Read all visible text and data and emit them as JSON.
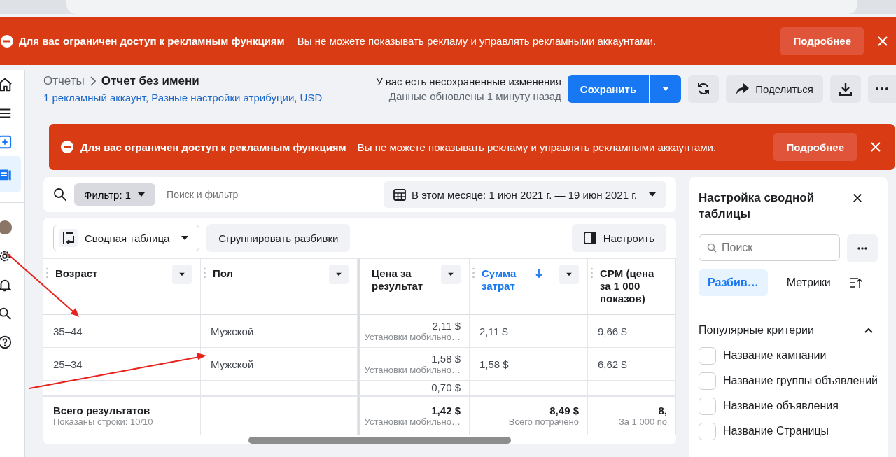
{
  "alert_banners": [
    {
      "title": "Для вас ограничен доступ к рекламным функциям",
      "message": "Вы не можете показывать рекламу и управлять рекламными аккаунтами.",
      "button": "Подробнее"
    },
    {
      "title": "Для вас ограничен доступ к рекламным функциям",
      "message": "Вы не можете показывать рекламу и управлять рекламными аккаунтами.",
      "button": "Подробнее"
    }
  ],
  "sidebar": {
    "items": [
      {
        "selected": false
      },
      {
        "selected": false
      },
      {
        "selected": false
      },
      {
        "selected": true
      },
      {
        "selected": false
      },
      {
        "selected": false
      },
      {
        "selected": false
      },
      {
        "selected": false
      },
      {
        "selected": false
      }
    ]
  },
  "header": {
    "breadcrumb": "Отчеты",
    "title": "Отчет без имени",
    "subtitle": "1 рекламный аккаунт, Разные настройки атрибуции, USD",
    "status": "У вас есть несохраненные изменения",
    "updated": "Данные обновлены 1 минуту назад",
    "save_button": "Сохранить",
    "share_button": "Поделиться"
  },
  "filter_bar": {
    "filter_chip": "Фильтр: 1",
    "placeholder": "Поиск и фильтр",
    "date_range": "В этом месяце: 1 июн 2021 г. — 19 июн 2021 г."
  },
  "toolbar": {
    "view_select": "Сводная таблица",
    "group_button": "Сгруппировать разбивки",
    "customize_button": "Настроить"
  },
  "table": {
    "columns": [
      {
        "label": "Возраст",
        "sorted": false
      },
      {
        "label": "Пол",
        "sorted": false
      },
      {
        "label": "Цена за результат",
        "sorted": false
      },
      {
        "label": "Сумма затрат",
        "sorted": true
      },
      {
        "label": "CPM (цена за 1 000 показов)",
        "sorted": false
      }
    ],
    "rows": [
      {
        "cells": [
          {
            "value": "35–44"
          },
          {
            "value": "Мужской"
          },
          {
            "value": "2,11 $",
            "note": "Установки мобильно…"
          },
          {
            "value": "2,11 $"
          },
          {
            "value": "9,66 $"
          }
        ]
      },
      {
        "cells": [
          {
            "value": "25–34"
          },
          {
            "value": "Мужской"
          },
          {
            "value": "1,58 $",
            "note": "Установки мобильно…"
          },
          {
            "value": "1,58 $"
          },
          {
            "value": "6,62 $"
          }
        ]
      },
      {
        "cells": [
          {},
          {},
          {
            "value": "0,70 $"
          },
          {},
          {}
        ]
      }
    ],
    "totals": {
      "label": "Всего результатов",
      "caption": "Показаны строки: 10/10",
      "metrics": [
        {
          "value": "1,42 $",
          "note": "Установки мобильно…"
        },
        {
          "value": "8,49 $",
          "note": "Всего потрачено"
        },
        {
          "value": "8,",
          "note": "За 1 000 по"
        }
      ]
    }
  },
  "panel": {
    "title": "Настройка сводной таблицы",
    "search_placeholder": "Поиск",
    "tabs": [
      {
        "label": "Разбив…",
        "selected": true
      },
      {
        "label": "Метрики",
        "selected": false
      }
    ],
    "section": {
      "title": "Популярные критерии",
      "expanded": true,
      "items": [
        {
          "label": "Название кампании",
          "checked": false
        },
        {
          "label": "Название группы объявлений",
          "checked": false
        },
        {
          "label": "Название объявления",
          "checked": false
        },
        {
          "label": "Название Страницы",
          "checked": false
        }
      ]
    }
  }
}
